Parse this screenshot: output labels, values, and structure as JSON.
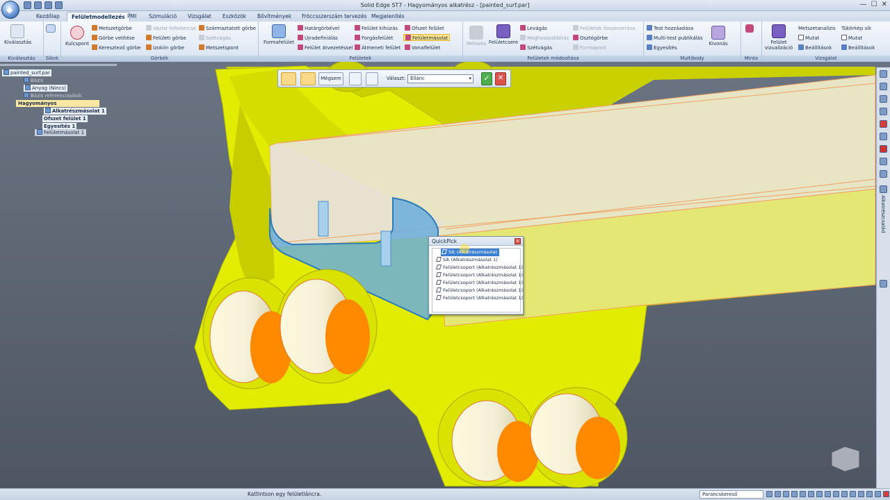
{
  "window": {
    "title": "Solid Edge ST7 - Hagyományos alkatrész - [painted_surf.par]"
  },
  "tabs": [
    {
      "label": "Kezdőlap"
    },
    {
      "label": "Felületmodellezés"
    },
    {
      "label": "PMI"
    },
    {
      "label": "Szimuláció"
    },
    {
      "label": "Vizsgálat"
    },
    {
      "label": "Eszközök"
    },
    {
      "label": "Bővítmények"
    },
    {
      "label": "Fröccsszerszám tervezés"
    },
    {
      "label": "Megjelenítés"
    }
  ],
  "ribbon": {
    "kivalasztas": {
      "group": "Kiválasztás",
      "button": "Kiválasztás"
    },
    "sikok": {
      "group": "Síkok"
    },
    "gorbek": {
      "group": "Görbék",
      "kulcspont": "Kulcspont",
      "items": [
        "Metszetgörbe",
        "Görbe vetítése",
        "Keresztező görbe",
        "Vázlat feltekercse",
        "Felületi görbe",
        "Izokiin görbe",
        "Származtatott görbe",
        "Szétvágás",
        "Metszetspont"
      ]
    },
    "feluletek": {
      "group": "Felületek",
      "formafelulet": "Formafelület",
      "items": [
        "Határgörbével",
        "Újradefiniálás",
        "Felület átvezetéssel",
        "Felület kihúzás",
        "Forgásfelület",
        "Átmeneti felület",
        "Ofszet felület",
        "Felületmásolat",
        "Vonalfelület"
      ]
    },
    "modositas": {
      "group": "Felületek módosítása",
      "metszes": "Metszés",
      "feluletcsere": "Felületcsere",
      "items": [
        "Levágás",
        "Meghosszabbítás",
        "Szétvágás",
        "Felületek összevarrása",
        "Osztógörbe",
        "Formapont"
      ]
    },
    "multibody": {
      "group": "Multibody",
      "items": [
        "Test hozzáadása",
        "Multi-test publikálás",
        "Egyesítés"
      ],
      "kivonas": "Kivonás"
    },
    "minta": {
      "group": "Minta"
    },
    "vizsgalat": {
      "group": "Vizsgálat",
      "vizualizacio": "Felület vizualizáció",
      "metszetanalizis": "Metszetanalízis",
      "mutat": "Mutat",
      "beallitasok": "Beállítások",
      "tukorkep": "Tükörkép sík",
      "mutat2": "Mutat",
      "beallitasok2": "Beállítások"
    }
  },
  "tree": {
    "root": "painted_surf.par",
    "items": [
      {
        "label": "Bázis"
      },
      {
        "label": "Anyag (Nincs)"
      },
      {
        "label": "Bázis referenciasíkok"
      },
      {
        "label": "Hagyományos"
      },
      {
        "label": "Alkatrészmásolat 1"
      },
      {
        "label": "Ofszet felület 1"
      },
      {
        "label": "Egyesítés 1"
      },
      {
        "label": "Felületmásolat 1"
      }
    ]
  },
  "command_bar": {
    "cancel": "Mégsem",
    "select_label": "Választ:",
    "select_value": "Éllánc"
  },
  "quickpick": {
    "title": "QuickPick",
    "items": [
      "Sík (Alkatrészmásolat 1)",
      "Sík (Alkatrészmásolat 1)",
      "Felületcsoport (Alkatrészmásolat 1)",
      "Felületcsoport (Alkatrészmásolat 1)",
      "Felületcsoport (Alkatrészmásolat 1)",
      "Felületcsoport (Alkatrészmásolat 1)",
      "Felületcsoport (Alkatrészmásolat 1)"
    ]
  },
  "right_panel": {
    "label": "Alkatrészcsalád"
  },
  "status": {
    "message": "Kattintson egy felületláncra.",
    "search_placeholder": "Parancskereső"
  },
  "colors": {
    "model_yellow": "#e2ec00",
    "model_orange": "#ff8a00",
    "highlight_blue": "#6aaedc",
    "background": "#5d6674"
  }
}
